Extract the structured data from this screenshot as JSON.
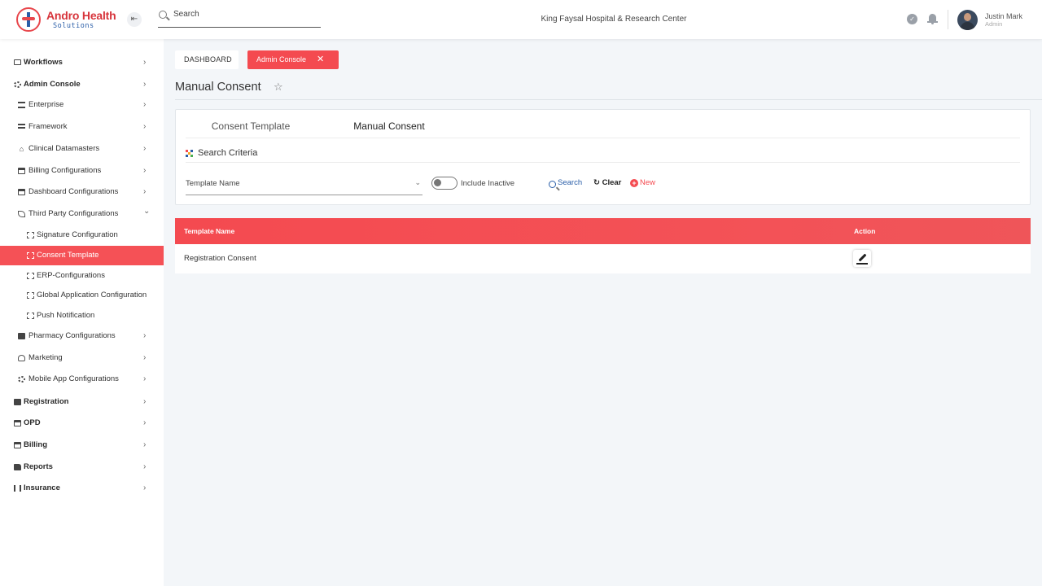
{
  "header": {
    "brand_name": "Andro Health",
    "brand_sub": "Solutions",
    "search_placeholder": "Search",
    "hospital": "King Faysal Hospital & Research Center",
    "user_name": "Justin Mark",
    "user_role": "Admin"
  },
  "sidebar": {
    "items": [
      {
        "label": "Workflows",
        "icon": "monitor-icon",
        "chevron": "›"
      },
      {
        "label": "Admin Console",
        "icon": "gear-icon",
        "chevron": "›"
      },
      {
        "label": "Enterprise",
        "icon": "bank-icon",
        "chevron": "›"
      },
      {
        "label": "Framework",
        "icon": "bars-icon",
        "chevron": "›"
      },
      {
        "label": "Clinical Datamasters",
        "icon": "home-icon",
        "chevron": "›"
      },
      {
        "label": "Billing Configurations",
        "icon": "card-icon",
        "chevron": "›"
      },
      {
        "label": "Dashboard Configurations",
        "icon": "card-icon",
        "chevron": "›"
      },
      {
        "label": "Third Party Configurations",
        "icon": "leaf-icon",
        "chevron": "⌄"
      },
      {
        "label": "Signature Configuration",
        "icon": "sitemap-icon"
      },
      {
        "label": "Consent Template",
        "icon": "sitemap-icon"
      },
      {
        "label": "ERP-Configurations",
        "icon": "sitemap-icon"
      },
      {
        "label": "Global Application Configuration",
        "icon": "sitemap-icon"
      },
      {
        "label": "Push Notification",
        "icon": "sitemap-icon"
      },
      {
        "label": "Pharmacy Configurations",
        "icon": "pharmacy-icon",
        "chevron": "›"
      },
      {
        "label": "Marketing",
        "icon": "person-icon",
        "chevron": "›"
      },
      {
        "label": "Mobile App Configurations",
        "icon": "gear-icon",
        "chevron": "›"
      },
      {
        "label": "Registration",
        "icon": "check-icon",
        "chevron": "›"
      },
      {
        "label": "OPD",
        "icon": "opd-icon",
        "chevron": "›"
      },
      {
        "label": "Billing",
        "icon": "card-icon",
        "chevron": "›"
      },
      {
        "label": "Reports",
        "icon": "document-icon",
        "chevron": "›"
      },
      {
        "label": "Insurance",
        "icon": "people-icon",
        "chevron": "›"
      }
    ]
  },
  "breadcrumb": {
    "dashboard": "DASHBOARD",
    "admin_console": "Admin Console",
    "close": "✕"
  },
  "page_title": "Manual Consent",
  "tabs": {
    "consent_template": "Consent Template",
    "manual_consent": "Manual Consent"
  },
  "search_criteria": {
    "title": "Search Criteria",
    "template_select": "Template Name",
    "include_inactive": "Include Inactive",
    "include_inactive_on": false,
    "search": "Search",
    "clear": "Clear",
    "new": "New"
  },
  "table": {
    "columns": [
      "Template Name",
      "Action"
    ],
    "rows": [
      {
        "template_name": "Registration Consent"
      }
    ]
  },
  "colors": {
    "accent": "#f44a50",
    "brand_red": "#d7353c",
    "brand_blue": "#2a5ea8"
  }
}
